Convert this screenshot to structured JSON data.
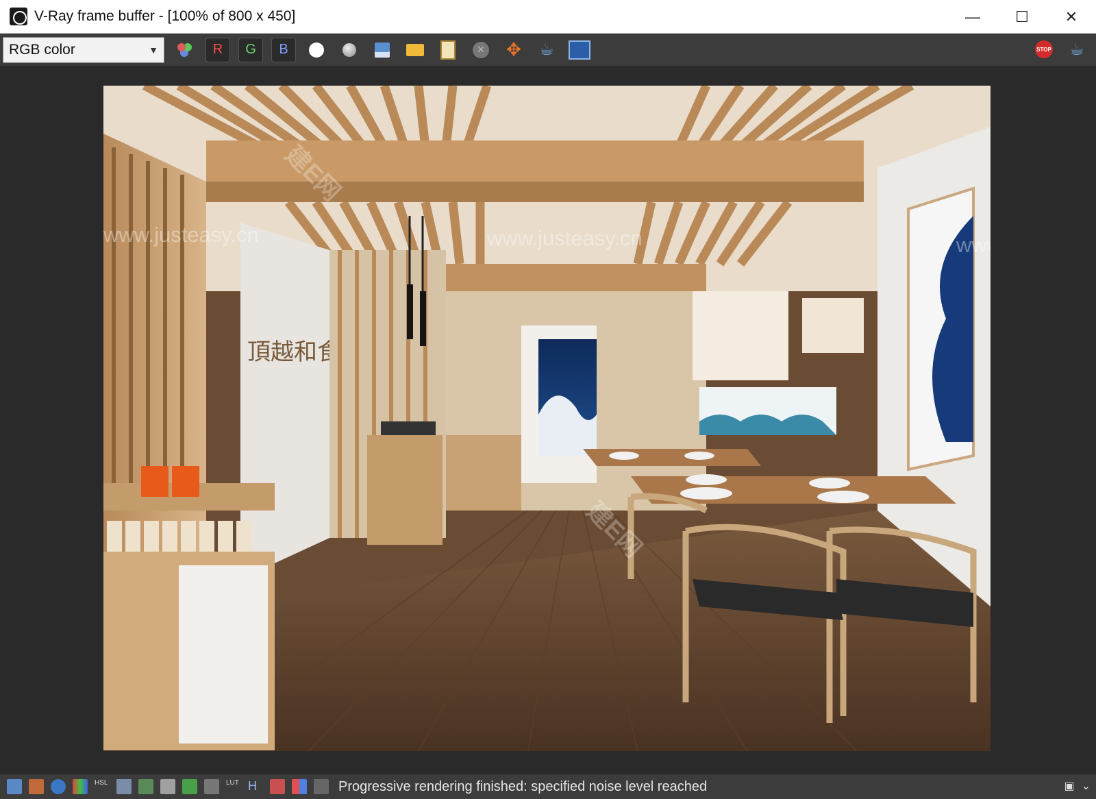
{
  "window": {
    "title": "V-Ray frame buffer - [100% of 800 x 450]",
    "minimize_glyph": "—",
    "maximize_glyph": "☐",
    "close_glyph": "✕"
  },
  "toolbar": {
    "channel_select_value": "RGB color",
    "channel_buttons": [
      "R",
      "G",
      "B"
    ],
    "icons": [
      "rgb-channels-icon",
      "white-dot-icon",
      "gray-sphere-icon",
      "save-icon",
      "open-folder-icon",
      "clipboard-icon",
      "clear-icon",
      "region-render-icon",
      "render-teapot-icon",
      "lut-icon",
      "stop-icon",
      "render-icon"
    ]
  },
  "render_image": {
    "watermarks": [
      "www.justeasy.cn",
      "www.justeasy.cn",
      "www",
      "建E网",
      "建E网"
    ],
    "wall_sign": "頂越和食"
  },
  "statusbar": {
    "message": "Progressive rendering finished: specified noise level reached",
    "icon_labels": [
      "HSL",
      "LUT",
      "H"
    ]
  },
  "colors": {
    "title_bar": "#ffffff",
    "toolbar": "#3c3c3c",
    "viewport": "#2a2a2a",
    "status_text": "#e6e6e6"
  }
}
